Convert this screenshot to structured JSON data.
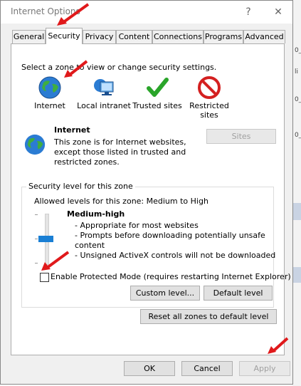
{
  "window": {
    "title": "Internet Options"
  },
  "titlebar": {
    "help": "?",
    "close": "✕"
  },
  "tabs": [
    {
      "label": "General"
    },
    {
      "label": "Security"
    },
    {
      "label": "Privacy"
    },
    {
      "label": "Content"
    },
    {
      "label": "Connections"
    },
    {
      "label": "Programs"
    },
    {
      "label": "Advanced"
    }
  ],
  "security": {
    "instruction": "Select a zone to view or change security settings.",
    "zones": [
      {
        "label": "Internet",
        "icon": "globe-icon"
      },
      {
        "label": "Local intranet",
        "icon": "network-monitor-icon"
      },
      {
        "label": "Trusted sites",
        "icon": "checkmark-icon"
      },
      {
        "label": "Restricted sites",
        "icon": "no-entry-icon"
      }
    ],
    "selected_zone": {
      "name": "Internet",
      "description": [
        "This zone is for Internet websites,",
        "except those listed in trusted and",
        "restricted zones."
      ]
    },
    "sites_button": "Sites",
    "level_group": {
      "title": "Security level for this zone",
      "allowed": "Allowed levels for this zone: Medium to High",
      "level_name": "Medium-high",
      "level_points": [
        "- Appropriate for most websites",
        "- Prompts before downloading potentially unsafe",
        "content",
        "- Unsigned ActiveX controls will not be downloaded"
      ],
      "level_fraction": 0.5
    },
    "protected_mode": {
      "label": "Enable Protected Mode (requires restarting Internet Explorer)",
      "checked": false
    },
    "custom_level_button": "Custom level...",
    "default_level_button": "Default level",
    "reset_button": "Reset all zones to default level"
  },
  "footer": {
    "ok": "OK",
    "cancel": "Cancel",
    "apply": "Apply"
  },
  "background_fragments": [
    "0_",
    "li",
    "0_",
    "0_"
  ],
  "colors": {
    "arrow": "#e0191b",
    "slider": "#1a7fd4"
  }
}
